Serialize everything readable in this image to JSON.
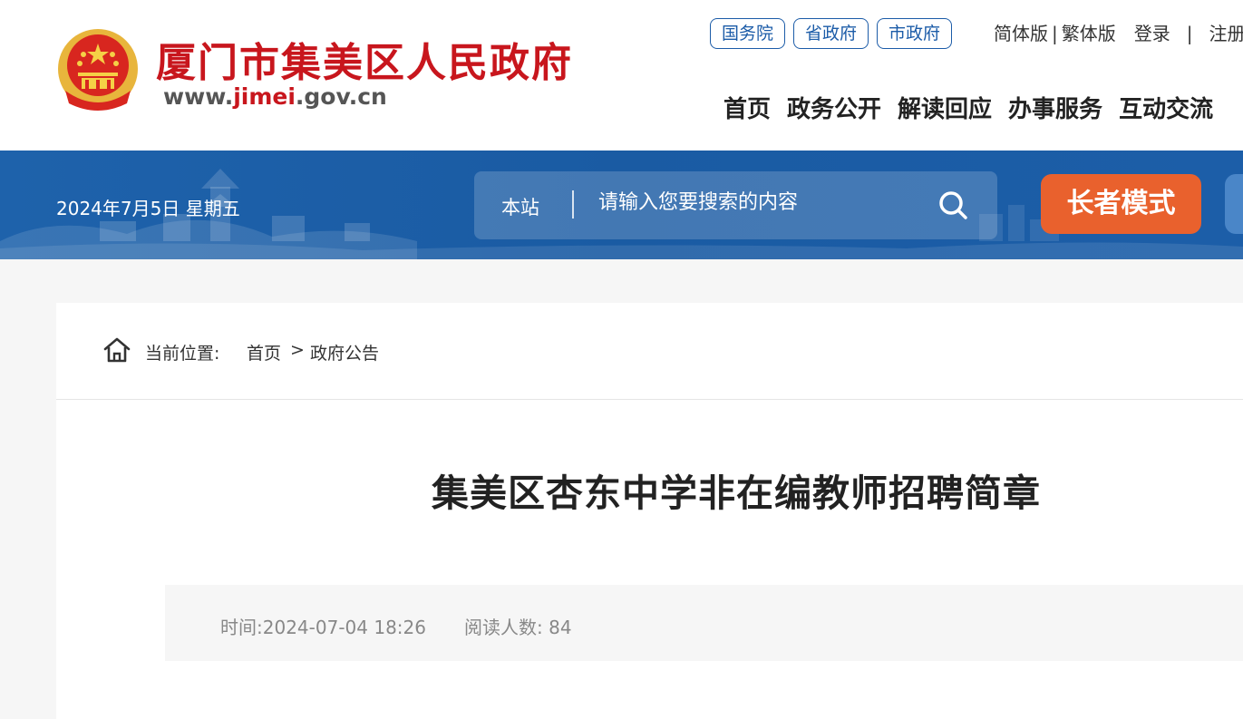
{
  "header": {
    "site_name": "厦门市集美区人民政府",
    "site_url_prefix": "www.",
    "site_url_highlight": "jimei",
    "site_url_suffix": ".gov.cn",
    "gov_links": [
      "国务院",
      "省政府",
      "市政府"
    ],
    "util": {
      "simplified": "简体版",
      "sep": "|",
      "traditional": "繁体版",
      "login": "登录",
      "register": "注册"
    },
    "nav": [
      "首页",
      "政务公开",
      "解读回应",
      "办事服务",
      "互动交流"
    ]
  },
  "banner": {
    "date": "2024年7月5日 星期五",
    "search_scope": "本站",
    "search_placeholder": "请输入您要搜索的内容",
    "elder_mode": "长者模式"
  },
  "breadcrumb": {
    "label": "当前位置:",
    "home": "首页",
    "separator": ">",
    "current": "政府公告"
  },
  "article": {
    "title": "集美区杏东中学非在编教师招聘简章",
    "time_label": "时间:",
    "time_value": "2024-07-04 18:26",
    "reads_label": "阅读人数:",
    "reads_value": "84"
  },
  "colors": {
    "brand_red": "#c8161d",
    "banner_blue": "#1c5ea8",
    "elder_orange": "#e9612d"
  },
  "icons": [
    "national-emblem-icon",
    "search-icon",
    "home-icon"
  ]
}
